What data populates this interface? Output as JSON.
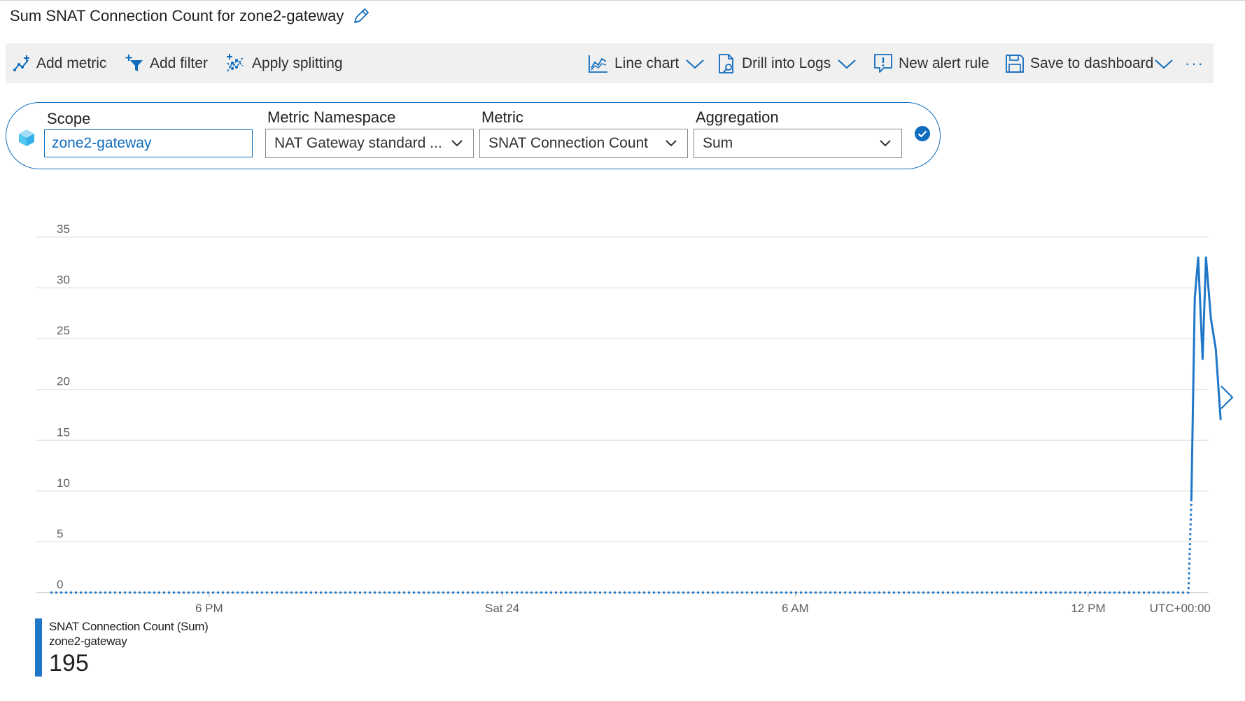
{
  "header": {
    "title": "Sum SNAT Connection Count for zone2-gateway"
  },
  "toolbar": {
    "add_metric": "Add metric",
    "add_filter": "Add filter",
    "apply_splitting": "Apply splitting",
    "line_chart": "Line chart",
    "drill_logs": "Drill into Logs",
    "new_alert": "New alert rule",
    "save_dashboard": "Save to dashboard",
    "more": "···"
  },
  "picker": {
    "scope_label": "Scope",
    "scope_value": "zone2-gateway",
    "namespace_label": "Metric Namespace",
    "namespace_value": "NAT Gateway standard ...",
    "metric_label": "Metric",
    "metric_value": "SNAT Connection Count",
    "aggregation_label": "Aggregation",
    "aggregation_value": "Sum"
  },
  "colors": {
    "accent": "#0f6cbd",
    "series": "#1f77c9",
    "gridline": "#dcdcdc",
    "toolbar_bg": "#f0f0f0"
  },
  "chart_data": {
    "type": "line",
    "ylim": [
      0,
      35
    ],
    "yticks": [
      0,
      5,
      10,
      15,
      20,
      25,
      30,
      35
    ],
    "xticks": [
      "6 PM",
      "Sat 24",
      "6 AM",
      "12 PM"
    ],
    "timezone_label": "UTC+00:00",
    "grid": true,
    "series": [
      {
        "name": "SNAT Connection Count (Sum)",
        "resource": "zone2-gateway",
        "color": "#1f77c9",
        "dotted_segment": [
          {
            "t_hours": 0,
            "value": 0
          },
          {
            "t_hours": 23.3,
            "value": 0
          },
          {
            "t_hours": 23.36,
            "value": 9
          }
        ],
        "values": [
          {
            "t_hours": 23.36,
            "value": 9
          },
          {
            "t_hours": 23.43,
            "value": 29
          },
          {
            "t_hours": 23.5,
            "value": 33
          },
          {
            "t_hours": 23.59,
            "value": 23
          },
          {
            "t_hours": 23.66,
            "value": 33
          },
          {
            "t_hours": 23.76,
            "value": 27
          },
          {
            "t_hours": 23.86,
            "value": 24
          },
          {
            "t_hours": 23.96,
            "value": 17
          }
        ]
      }
    ],
    "xtick_hours": [
      3.25,
      9.25,
      15.25,
      21.25
    ],
    "legend": {
      "series_label": "SNAT Connection Count (Sum)",
      "resource_label": "zone2-gateway",
      "total": "195"
    }
  }
}
